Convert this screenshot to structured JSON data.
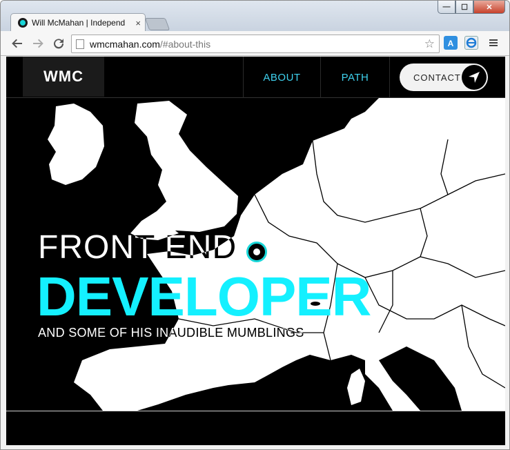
{
  "browser": {
    "tab_title": "Will McMahan | Independ",
    "tab_close": "×",
    "url_host": "wmcmahan.com",
    "url_path": "/#about-this",
    "window_controls": {
      "minimize": "—",
      "maximize": "☐",
      "close": "✕"
    }
  },
  "icons": [
    "back-arrow-icon",
    "forward-arrow-icon",
    "reload-icon",
    "page-icon",
    "bookmark-star-icon",
    "translate-icon",
    "ie-tab-icon",
    "menu-icon",
    "navigation-arrow-icon"
  ],
  "site": {
    "logo": "WMC",
    "nav": {
      "about": "ABOUT",
      "path": "PATH",
      "contact": "CONTACT"
    },
    "hero": {
      "line1": "FRONT END",
      "line2": "DEVELOPER",
      "line3": "AND SOME OF HIS INAUDIBLE MUMBLINGS"
    }
  },
  "colors": {
    "accent": "#14f0ff",
    "nav_link": "#3fd2ef",
    "background": "#000000",
    "land": "#ffffff"
  }
}
